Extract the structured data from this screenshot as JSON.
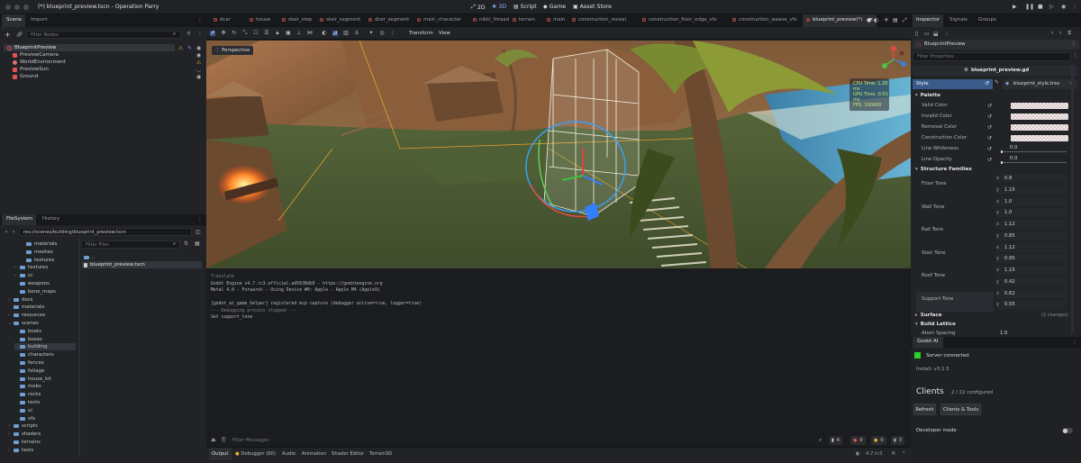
{
  "window": {
    "title": "(*) blueprint_preview.tscn - Operation Parry",
    "modes": [
      {
        "label": "2D"
      },
      {
        "label": "3D"
      },
      {
        "label": "Script"
      },
      {
        "label": "Game"
      },
      {
        "label": "Asset Store"
      }
    ],
    "right_controls": [
      "play-icon",
      "pause-icon",
      "stop-icon",
      "play-scene-icon",
      "play-custom-icon",
      "movie-icon",
      "settings-icon"
    ]
  },
  "scene_dock": {
    "tabs": [
      "Scene",
      "Import"
    ],
    "filter_placeholder": "Filter Nodes",
    "nodes": [
      {
        "name": "BlueprintPreview",
        "color": "#e05252",
        "selected": true
      },
      {
        "name": "PreviewCamera",
        "color": "#e05252"
      },
      {
        "name": "WorldEnvironment",
        "color": "#e05252"
      },
      {
        "name": "PreviewSun",
        "color": "#e05252"
      },
      {
        "name": "Ground",
        "color": "#e05252"
      }
    ]
  },
  "editor_tabs": [
    "dcar",
    "house",
    "stair_step",
    "stair_segment",
    "dcer_segment",
    "main_character",
    "nikki_thread",
    "terrain",
    "main",
    "construction_reveal",
    "construction_floor_edge_vfx",
    "construction_weave_vfx",
    "blueprint_preview(*)"
  ],
  "viewport": {
    "toolbar_labels": [
      "Transform",
      "View"
    ],
    "perspective_label": "Perspective",
    "stats": [
      "CPU Time: 1.20 ms",
      "GPU Time: 0.01 ms",
      "FPS: 100000"
    ]
  },
  "filesystem": {
    "tabs": [
      "FileSystem",
      "History"
    ],
    "path": "res://scenes/building/blueprint_preview.tscn",
    "filter_placeholder": "Filter Files",
    "tree": [
      {
        "label": "materials",
        "depth": 2
      },
      {
        "label": "meshes",
        "depth": 2
      },
      {
        "label": "textures",
        "depth": 2
      },
      {
        "label": "textures",
        "depth": 1,
        "collapsed": true
      },
      {
        "label": "ui",
        "depth": 1,
        "collapsed": true
      },
      {
        "label": "weapons",
        "depth": 1
      },
      {
        "label": "bone_maps",
        "depth": 1
      },
      {
        "label": "docs",
        "depth": 0,
        "collapsed": true
      },
      {
        "label": "materials",
        "depth": 0
      },
      {
        "label": "resources",
        "depth": 0,
        "collapsed": true
      },
      {
        "label": "scenes",
        "depth": 0,
        "expanded": true
      },
      {
        "label": "boats",
        "depth": 1
      },
      {
        "label": "boxes",
        "depth": 1
      },
      {
        "label": "building",
        "depth": 1,
        "selected": true
      },
      {
        "label": "characters",
        "depth": 1
      },
      {
        "label": "fences",
        "depth": 1
      },
      {
        "label": "foliage",
        "depth": 1
      },
      {
        "label": "house_kit",
        "depth": 1
      },
      {
        "label": "mobs",
        "depth": 1
      },
      {
        "label": "rocks",
        "depth": 1
      },
      {
        "label": "tests",
        "depth": 1
      },
      {
        "label": "ui",
        "depth": 1
      },
      {
        "label": "vfx",
        "depth": 1
      },
      {
        "label": "scripts",
        "depth": 0,
        "collapsed": true
      },
      {
        "label": "shaders",
        "depth": 0,
        "collapsed": true
      },
      {
        "label": "terrains",
        "depth": 0
      },
      {
        "label": "tests",
        "depth": 0,
        "collapsed": true
      }
    ],
    "files": [
      {
        "label": ".."
      },
      {
        "label": "blueprint_preview.tscn",
        "selected": true
      }
    ]
  },
  "output": {
    "lines": [
      "Translate",
      "Godot Engine v4.7.rc3.official.ad5638db9 - https://godotengine.org",
      "Metal 4.0 - Forward+ - Using Device #0: Apple - Apple M4 (Apple9)",
      "",
      "[godot_ai_game_helper] registered mcp capture (debugger active=true, logger=true)",
      "--- Debugging process stopped ---",
      "Set support_tone"
    ],
    "filter_placeholder": "Filter Messages",
    "counts": [
      {
        "label": "4",
        "color": "#d0d0d0"
      },
      {
        "label": "0",
        "color": "#e05252"
      },
      {
        "label": "0",
        "color": "#e0b030"
      },
      {
        "label": "3",
        "color": "#bbbbbb"
      }
    ],
    "bottom_tabs": [
      "Output",
      "Debugger (60)",
      "Audio",
      "Animation",
      "Shader Editor",
      "Terrain3D"
    ],
    "version": "4.7.rc3"
  },
  "inspector": {
    "tabs": [
      "Inspector",
      "Signals",
      "Groups"
    ],
    "node_name": "BlueprintPreview",
    "filter_placeholder": "Filter Properties",
    "resource_title": "blueprint_preview.gd",
    "style_label": "Style",
    "style_resource": "blueprint_style.tres",
    "palette_header": "Palette",
    "colors": [
      "Valid Color",
      "Invalid Color",
      "Removal Color",
      "Construction Color"
    ],
    "sliders": [
      {
        "label": "Line Whiteness",
        "value": "0.0"
      },
      {
        "label": "Line Opacity",
        "value": "0.0"
      }
    ],
    "families_header": "Structure Families",
    "families": [
      {
        "label": "Floor Tone",
        "values": [
          "0.8",
          "1.15"
        ]
      },
      {
        "label": "Wall Tone",
        "values": [
          "1.0",
          "1.0"
        ]
      },
      {
        "label": "Rail Tone",
        "values": [
          "1.12",
          "0.85"
        ]
      },
      {
        "label": "Stair Tone",
        "values": [
          "1.12",
          "0.95"
        ]
      },
      {
        "label": "Roof Tone",
        "values": [
          "1.15",
          "0.42"
        ]
      },
      {
        "label": "Support Tone",
        "values": [
          "0.62",
          "0.55"
        ]
      }
    ],
    "surface_label": "Surface",
    "surface_changes": "(2 changes)",
    "lattice_header": "Build Lattice",
    "atom_spacing_label": "Atom Spacing",
    "atom_spacing_value": "1.0"
  },
  "godot_ai": {
    "title": "Godot AI",
    "status": "Server connected",
    "install": "Install: v3.1.5",
    "clients_title": "Clients",
    "clients_count": "2 / 22 configured",
    "refresh_label": "Refresh",
    "clients_tools_label": "Clients & Tools",
    "dev_mode_label": "Developer mode"
  }
}
